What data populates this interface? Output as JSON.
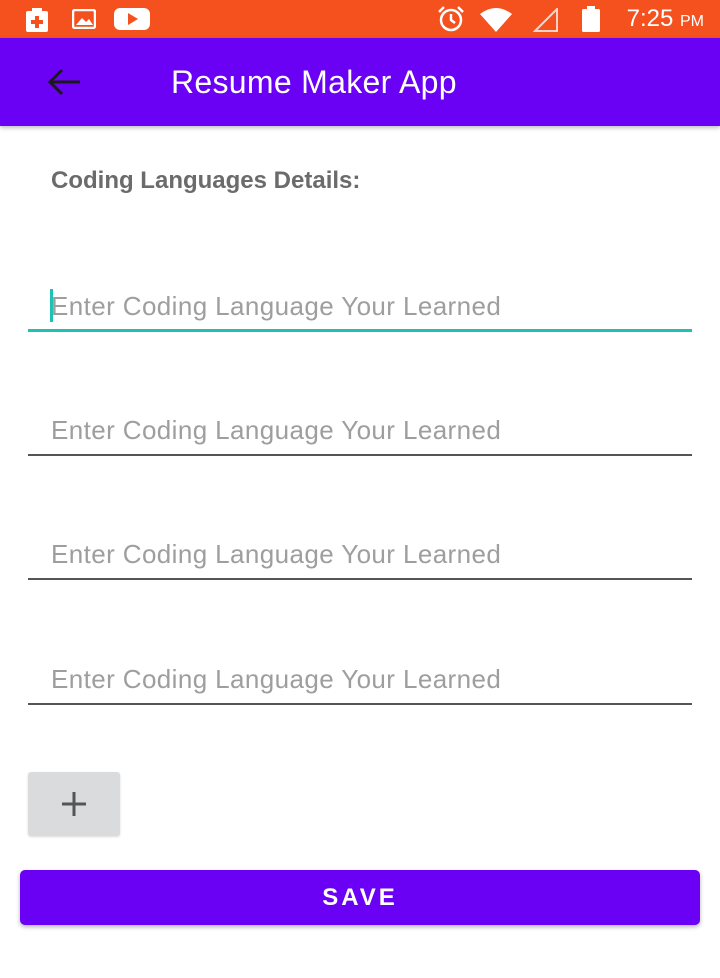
{
  "status_bar": {
    "icons": [
      "battery-saver-icon",
      "image-icon",
      "youtube-icon",
      "alarm-icon",
      "wifi-icon",
      "signal-icon",
      "battery-icon"
    ],
    "time": "7:25",
    "ampm": "PM",
    "color": "#f4511e"
  },
  "app_bar": {
    "title": "Resume Maker App",
    "back_icon": "arrow-back-icon",
    "color": "#6a00f4"
  },
  "form": {
    "heading": "Coding Languages Details:",
    "fields": [
      {
        "placeholder": "Enter Coding Language Your Learned",
        "value": "",
        "focused": true
      },
      {
        "placeholder": "Enter Coding Language Your Learned",
        "value": "",
        "focused": false
      },
      {
        "placeholder": "Enter Coding Language Your Learned",
        "value": "",
        "focused": false
      },
      {
        "placeholder": "Enter Coding Language Your Learned",
        "value": "",
        "focused": false
      }
    ],
    "focus_color": "#1fc2b2",
    "add_icon": "plus-icon",
    "save_label": "SAVE"
  }
}
